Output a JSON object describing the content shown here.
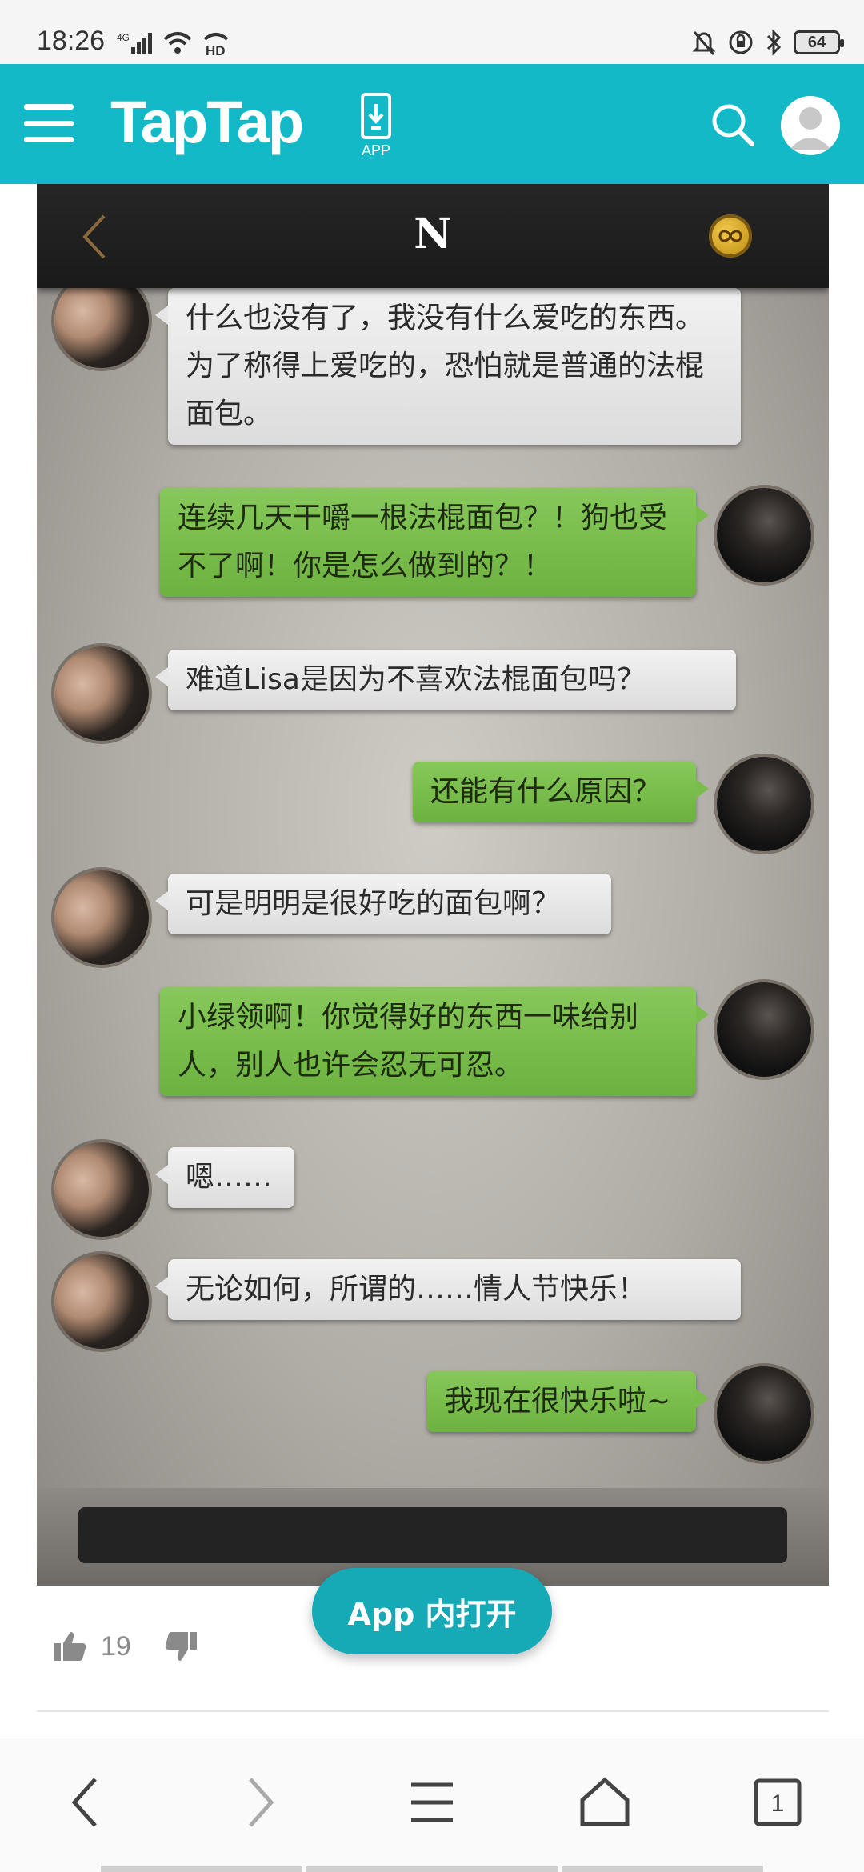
{
  "status_bar": {
    "time": "18:26",
    "network": "4G",
    "hd_label": "HD",
    "battery": "64"
  },
  "header": {
    "logo": "TapTap",
    "app_label": "APP",
    "brand_color": "#14b9c8"
  },
  "game": {
    "title": "N",
    "messages": [
      {
        "side": "left",
        "text": "什么也没有了，我没有什么爱吃的东西。为了称得上爱吃的，恐怕就是普通的法棍面包。"
      },
      {
        "side": "right",
        "text": "连续几天干嚼一根法棍面包？！狗也受不了啊！你是怎么做到的？！"
      },
      {
        "side": "left",
        "text": "难道Lisa是因为不喜欢法棍面包吗？"
      },
      {
        "side": "right",
        "text": "还能有什么原因？"
      },
      {
        "side": "left",
        "text": "可是明明是很好吃的面包啊？"
      },
      {
        "side": "right",
        "text": "小绿领啊！你觉得好的东西一味给别人，别人也许会忍无可忍。"
      },
      {
        "side": "left",
        "text": "嗯……"
      },
      {
        "side": "left",
        "text": "无论如何，所谓的……情人节快乐！"
      },
      {
        "side": "right",
        "text": "我现在很快乐啦~"
      }
    ]
  },
  "open_app_button": "App 内打开",
  "likes": {
    "count": "19"
  },
  "bottom_nav": {
    "tabs_count": "1"
  }
}
